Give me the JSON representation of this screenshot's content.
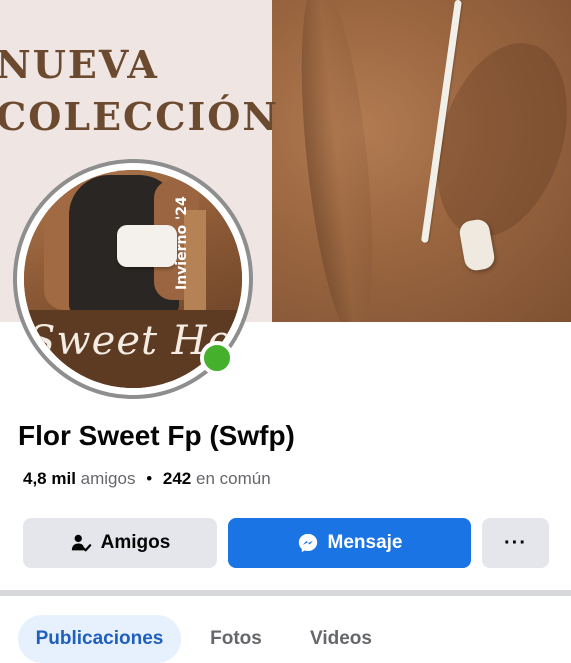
{
  "cover": {
    "line1": "NUEVA",
    "line2": "COLECCIÓN"
  },
  "avatar": {
    "vertical_text": "Invierno '24",
    "script_text": "Sweet Ho",
    "online": true
  },
  "profile": {
    "name": "Flor Sweet Fp (Swfp)",
    "friends_count": "4,8 mil",
    "friends_label": "amigos",
    "separator": "•",
    "mutual_count": "242",
    "mutual_label": "en común"
  },
  "actions": {
    "friends_label": "Amigos",
    "friends_icon": "friend-check-icon",
    "message_label": "Mensaje",
    "message_icon": "messenger-icon",
    "more_label": "···"
  },
  "tabs": [
    {
      "label": "Publicaciones",
      "active": true
    },
    {
      "label": "Fotos",
      "active": false
    },
    {
      "label": "Videos",
      "active": false
    }
  ],
  "colors": {
    "primary": "#1b74e4",
    "online": "#44b02c",
    "secondary_button": "#e4e6eb",
    "active_tab_bg": "#e7f0fd",
    "active_tab_text": "#1f5fbd"
  }
}
